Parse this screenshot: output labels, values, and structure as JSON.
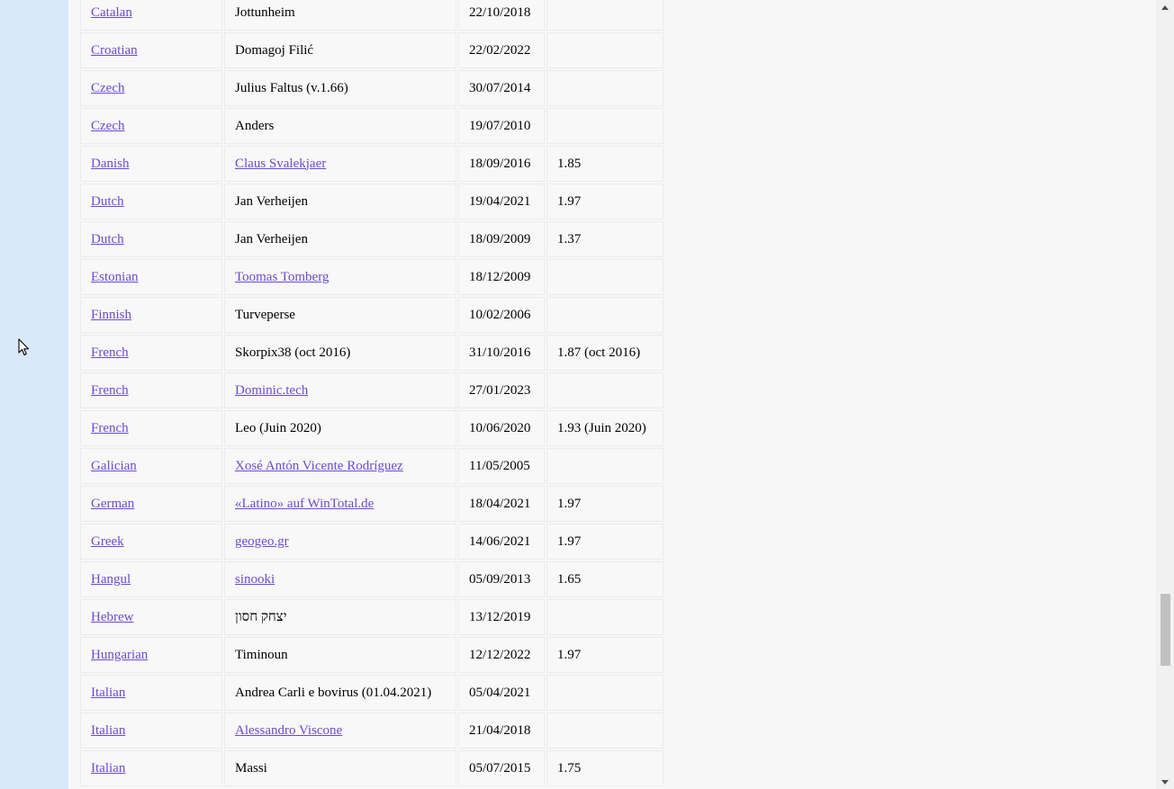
{
  "table": {
    "rows": [
      {
        "language": "Catalan",
        "translator": "Jottunheim",
        "translator_link": false,
        "date": "22/10/2018",
        "version": ""
      },
      {
        "language": "Croatian",
        "translator": "Domagoj Filić",
        "translator_link": false,
        "date": "22/02/2022",
        "version": ""
      },
      {
        "language": "Czech",
        "translator": "Julius Faltus (v.1.66)",
        "translator_link": false,
        "date": "30/07/2014",
        "version": ""
      },
      {
        "language": "Czech",
        "translator": "Anders",
        "translator_link": false,
        "date": "19/07/2010",
        "version": ""
      },
      {
        "language": "Danish",
        "translator": "Claus Svalekjaer",
        "translator_link": true,
        "date": "18/09/2016",
        "version": "1.85"
      },
      {
        "language": "Dutch",
        "translator": "Jan Verheijen",
        "translator_link": false,
        "date": "19/04/2021",
        "version": "1.97"
      },
      {
        "language": "Dutch",
        "translator": "Jan Verheijen",
        "translator_link": false,
        "date": "18/09/2009",
        "version": "1.37"
      },
      {
        "language": "Estonian",
        "translator": "Toomas Tomberg",
        "translator_link": true,
        "date": "18/12/2009",
        "version": ""
      },
      {
        "language": "Finnish",
        "translator": "Turveperse",
        "translator_link": false,
        "date": "10/02/2006",
        "version": ""
      },
      {
        "language": "French",
        "translator": "Skorpix38 (oct 2016)",
        "translator_link": false,
        "date": "31/10/2016",
        "version": "1.87 (oct 2016)"
      },
      {
        "language": "French",
        "translator": "Dominic.tech",
        "translator_link": true,
        "date": "27/01/2023",
        "version": ""
      },
      {
        "language": "French",
        "translator": "Leo (Juin 2020)",
        "translator_link": false,
        "date": "10/06/2020",
        "version": "1.93 (Juin 2020)"
      },
      {
        "language": "Galician",
        "translator": "Xosé Antón Vicente Rodríguez",
        "translator_link": true,
        "date": "11/05/2005",
        "version": ""
      },
      {
        "language": "German",
        "translator": "«Latino» auf WinTotal.de",
        "translator_link": true,
        "date": "18/04/2021",
        "version": "1.97"
      },
      {
        "language": "Greek",
        "translator": "geogeo.gr",
        "translator_link": true,
        "date": "14/06/2021",
        "version": "1.97"
      },
      {
        "language": "Hangul",
        "translator": "sinooki",
        "translator_link": true,
        "date": "05/09/2013",
        "version": "1.65"
      },
      {
        "language": "Hebrew",
        "translator": "יצחק חסון",
        "translator_link": false,
        "date": "13/12/2019",
        "version": ""
      },
      {
        "language": "Hungarian",
        "translator": "Timinoun",
        "translator_link": false,
        "date": "12/12/2022",
        "version": "1.97"
      },
      {
        "language": "Italian",
        "translator": "Andrea Carli e bovirus (01.04.2021)",
        "translator_link": false,
        "date": "05/04/2021",
        "version": ""
      },
      {
        "language": "Italian",
        "translator": "Alessandro Viscone",
        "translator_link": true,
        "date": "21/04/2018",
        "version": ""
      },
      {
        "language": "Italian",
        "translator": "Massi",
        "translator_link": false,
        "date": "05/07/2015",
        "version": "1.75"
      }
    ]
  },
  "colors": {
    "link": "#6a4bd1",
    "sidebar": "#d9e8fb",
    "background": "#f7f7f7"
  },
  "icons": {
    "cursor": "mouse-pointer-icon",
    "scroll_up": "scroll-up-arrow-icon",
    "scroll_down": "scroll-down-arrow-icon"
  }
}
